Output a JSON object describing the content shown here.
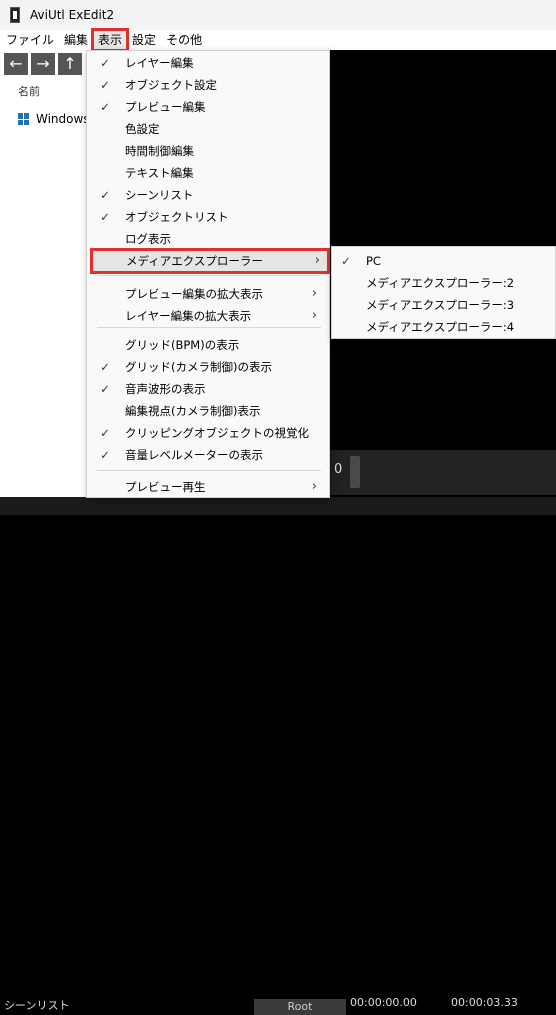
{
  "window": {
    "title": "AviUtl ExEdit2"
  },
  "menubar": [
    "ファイル",
    "編集",
    "表示",
    "設定",
    "その他"
  ],
  "nav": {
    "back": "←",
    "forward": "→",
    "up": "↑"
  },
  "explorer": {
    "column_header": "名前",
    "tree_item": "Windows"
  },
  "view_menu": {
    "items": [
      {
        "label": "レイヤー編集",
        "checked": true
      },
      {
        "label": "オブジェクト設定",
        "checked": true
      },
      {
        "label": "プレビュー編集",
        "checked": true
      },
      {
        "label": "色設定",
        "checked": false
      },
      {
        "label": "時間制御編集",
        "checked": false
      },
      {
        "label": "テキスト編集",
        "checked": false
      },
      {
        "label": "シーンリスト",
        "checked": true
      },
      {
        "label": "オブジェクトリスト",
        "checked": true
      },
      {
        "label": "ログ表示",
        "checked": false
      },
      {
        "label": "メディアエクスプローラー",
        "checked": false,
        "submenu": true
      },
      {
        "label": "プレビュー編集の拡大表示",
        "checked": false,
        "submenu": true
      },
      {
        "label": "レイヤー編集の拡大表示",
        "checked": false,
        "submenu": true
      },
      {
        "label": "グリッド(BPM)の表示",
        "checked": false
      },
      {
        "label": "グリッド(カメラ制御)の表示",
        "checked": true
      },
      {
        "label": "音声波形の表示",
        "checked": true
      },
      {
        "label": "編集視点(カメラ制御)表示",
        "checked": false
      },
      {
        "label": "クリッピングオブジェクトの視覚化",
        "checked": true
      },
      {
        "label": "音量レベルメーターの表示",
        "checked": true
      },
      {
        "label": "プレビュー再生",
        "checked": false,
        "submenu": true
      }
    ]
  },
  "submenu": {
    "items": [
      {
        "label": "PC",
        "checked": true
      },
      {
        "label": "メディアエクスプローラー:2",
        "checked": false
      },
      {
        "label": "メディアエクスプローラー:3",
        "checked": false
      },
      {
        "label": "メディアエクスプローラー:4",
        "checked": false
      }
    ]
  },
  "glyphs": {
    "check": "✓",
    "arrow": "›"
  },
  "timeline": {
    "zero": "0",
    "scene_list": "シーンリスト",
    "root": "Root",
    "time_start": "00:00:00.00",
    "time_end": "00:00:03.33"
  },
  "colors": {
    "highlight_outline": "#e03131"
  }
}
